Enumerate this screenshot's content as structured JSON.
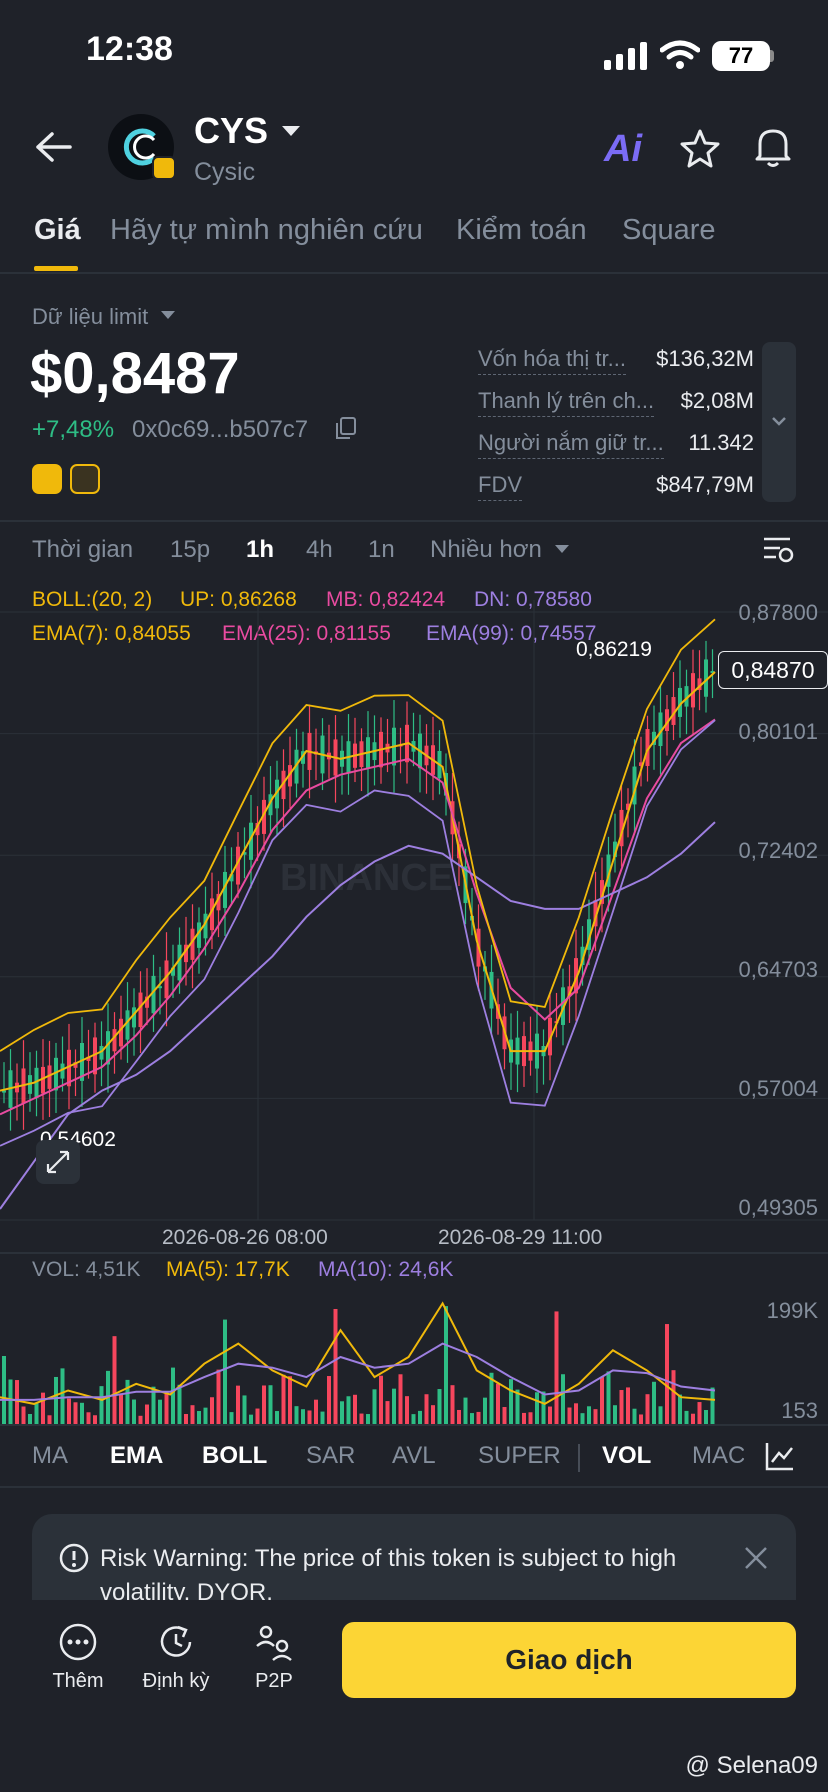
{
  "status": {
    "time": "12:38",
    "battery": "77"
  },
  "header": {
    "symbol": "CYS",
    "name": "Cysic",
    "ai_label": "Ai"
  },
  "tabs": [
    "Giá",
    "Hãy tự mình nghiên cứu",
    "Kiểm toán",
    "Square"
  ],
  "price_section": {
    "limit_label": "Dữ liệu limit",
    "price": "$0,8487",
    "change": "+7,48%",
    "contract": "0x0c69...b507c7"
  },
  "stats": [
    {
      "label": "Vốn hóa thị tr...",
      "value": "$136,32M"
    },
    {
      "label": "Thanh lý trên ch...",
      "value": "$2,08M"
    },
    {
      "label": "Người nắm giữ tr...",
      "value": "11.342"
    },
    {
      "label": "FDV",
      "value": "$847,79M"
    }
  ],
  "timeframes": [
    "Thời gian",
    "15p",
    "1h",
    "4h",
    "1n",
    "Nhiều hơn"
  ],
  "indicators": {
    "boll": "BOLL:(20, 2)",
    "up": "UP: 0,86268",
    "mb": "MB: 0,82424",
    "dn": "DN: 0,78580",
    "ema7": "EMA(7): 0,84055",
    "ema25": "EMA(25): 0,81155",
    "ema99": "EMA(99): 0,74557"
  },
  "chart": {
    "y_axis": [
      "0,87800",
      "0,80101",
      "0,72402",
      "0,64703",
      "0,57004",
      "0,49305"
    ],
    "x_axis": [
      "2026-08-26 08:00",
      "2026-08-29 11:00"
    ],
    "high_label": "0,86219",
    "low_label": "0,54602",
    "last_price": "0,84870",
    "watermark": "BINANCE"
  },
  "volume": {
    "vol": "VOL: 4,51K",
    "ma5": "MA(5): 17,7K",
    "ma10": "MA(10): 24,6K",
    "y_top": "199K",
    "y_bottom": "153"
  },
  "indicator_bar": [
    "MA",
    "EMA",
    "BOLL",
    "SAR",
    "AVL",
    "SUPER",
    "VOL",
    "MAC"
  ],
  "risk_warning": "Risk Warning: The price of this token is subject to high volatility. DYOR.",
  "bottom_nav": {
    "more": "Thêm",
    "recurring": "Định kỳ",
    "p2p": "P2P",
    "trade": "Giao dịch"
  },
  "footer_watermark": "@ Selena09",
  "colors": {
    "accent": "#f0b90b",
    "up": "#2ebd85",
    "down": "#f6465d",
    "ema7": "#f0b90b",
    "ema25": "#e84ba0",
    "ema99": "#9d7fe0"
  },
  "chart_data": {
    "type": "line",
    "title": "",
    "xlabel": "",
    "ylabel": "",
    "x_ticks": [
      "2026-08-26 08:00",
      "2026-08-29 11:00"
    ],
    "y_ticks": [
      0.878,
      0.80101,
      0.72402,
      0.64703,
      0.57004,
      0.49305
    ],
    "ylim": [
      0.49305,
      0.878
    ],
    "annotations": {
      "high": 0.86219,
      "low": 0.54602,
      "last": 0.8487
    },
    "series": [
      {
        "name": "EMA(7)",
        "values": [
          0.575,
          0.58,
          0.59,
          0.6,
          0.625,
          0.65,
          0.68,
          0.72,
          0.76,
          0.79,
          0.785,
          0.79,
          0.795,
          0.78,
          0.67,
          0.6,
          0.6,
          0.65,
          0.72,
          0.79,
          0.82,
          0.84
        ]
      },
      {
        "name": "EMA(25)",
        "values": [
          0.56,
          0.57,
          0.58,
          0.59,
          0.61,
          0.635,
          0.665,
          0.7,
          0.74,
          0.765,
          0.775,
          0.78,
          0.785,
          0.77,
          0.7,
          0.64,
          0.62,
          0.64,
          0.7,
          0.76,
          0.795,
          0.81
        ]
      },
      {
        "name": "EMA(99)",
        "values": [
          0.5,
          0.53,
          0.56,
          0.575,
          0.585,
          0.6,
          0.62,
          0.64,
          0.66,
          0.685,
          0.705,
          0.72,
          0.73,
          0.725,
          0.71,
          0.695,
          0.69,
          0.69,
          0.7,
          0.71,
          0.725,
          0.745
        ]
      }
    ],
    "volume_series": [
      {
        "name": "MA(5)",
        "values": [
          20,
          15,
          25,
          18,
          30,
          22,
          45,
          60,
          40,
          28,
          70,
          35,
          50,
          90,
          40,
          25,
          15,
          30,
          55,
          40,
          20,
          18
        ]
      },
      {
        "name": "MA(10)",
        "values": [
          18,
          18,
          20,
          20,
          24,
          24,
          35,
          45,
          42,
          35,
          50,
          42,
          45,
          60,
          50,
          35,
          22,
          25,
          40,
          38,
          28,
          25
        ]
      }
    ]
  }
}
